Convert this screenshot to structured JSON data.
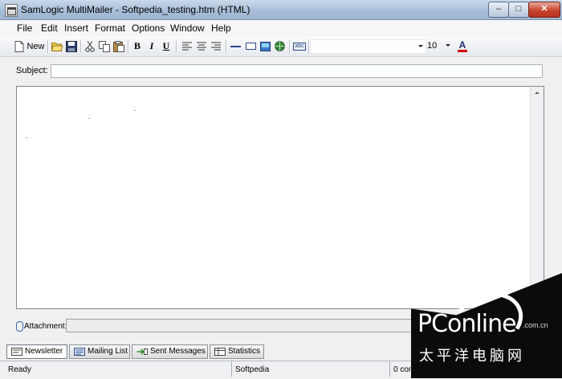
{
  "window": {
    "title": "SamLogic MultiMailer - Softpedia_testing.htm  (HTML)",
    "min_glyph": "–",
    "max_glyph": "□",
    "close_glyph": "✕"
  },
  "menu": [
    "File",
    "Edit",
    "Insert",
    "Format",
    "Options",
    "Window",
    "Help"
  ],
  "toolbar": {
    "new_label": "New",
    "font_name": "",
    "font_size": "10",
    "icons": [
      "new-document-icon",
      "open-folder-icon",
      "save-icon",
      "cut-icon",
      "copy-icon",
      "paste-icon",
      "bold-icon",
      "italic-icon",
      "underline-icon",
      "align-left-icon",
      "align-center-icon",
      "align-right-icon",
      "horizontal-line-icon",
      "text-box-icon",
      "insert-image-icon",
      "hyperlink-globe-icon",
      "spell-check-icon",
      "font-color-icon"
    ],
    "bold_glyph": "B",
    "italic_glyph": "I",
    "underline_glyph": "U",
    "spell_label": "abc",
    "fontcolor_glyph": "A",
    "accent_color": "#d40000"
  },
  "subject": {
    "label": "Subject:",
    "value": ""
  },
  "attachment": {
    "label": "Attachment:",
    "value": ""
  },
  "tabs": [
    {
      "label": "Newsletter",
      "active": true,
      "icon": "newsletter-icon"
    },
    {
      "label": "Mailing List",
      "active": false,
      "icon": "mailing-list-icon"
    },
    {
      "label": "Sent Messages",
      "active": false,
      "icon": "sent-messages-icon"
    },
    {
      "label": "Statistics",
      "active": false,
      "icon": "statistics-icon"
    }
  ],
  "status": {
    "state": "Ready",
    "publisher": "Softpedia",
    "count": "0 cont"
  },
  "watermark": {
    "logo": "PConline",
    "domain": ".com.cn",
    "chinese": "太平洋电脑网"
  }
}
